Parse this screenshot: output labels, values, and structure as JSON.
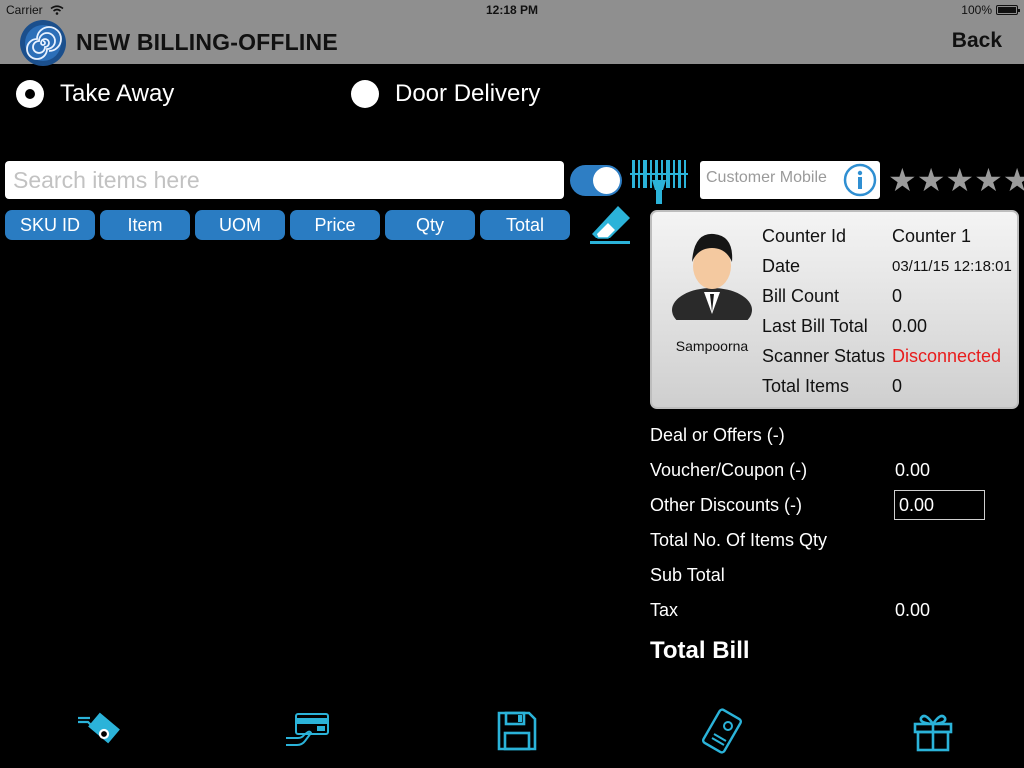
{
  "status_bar": {
    "carrier": "Carrier",
    "time": "12:18 PM",
    "battery": "100%"
  },
  "nav": {
    "title": "NEW BILLING-OFFLINE",
    "back_label": "Back"
  },
  "order_type": {
    "options": [
      {
        "label": "Take Away",
        "selected": true
      },
      {
        "label": "Door Delivery",
        "selected": false
      }
    ]
  },
  "search": {
    "placeholder": "Search items here",
    "value": ""
  },
  "scanner_toggle": {
    "on": true
  },
  "customer": {
    "placeholder": "Customer Mobile",
    "rating": 0,
    "rating_max": 5
  },
  "columns": [
    "SKU ID",
    "Item",
    "UOM",
    "Price",
    "Qty",
    "Total"
  ],
  "counter_card": {
    "user_name": "Sampoorna",
    "rows": [
      {
        "label": "Counter Id",
        "value": "Counter 1"
      },
      {
        "label": "Date",
        "value": "03/11/15 12:18:01"
      },
      {
        "label": "Bill Count",
        "value": "0"
      },
      {
        "label": "Last Bill Total",
        "value": "0.00"
      },
      {
        "label": "Scanner Status",
        "value": "Disconnected"
      },
      {
        "label": "Total Items",
        "value": "0"
      }
    ]
  },
  "summary": {
    "deals_label": "Deal or Offers (-)",
    "voucher_label": "Voucher/Coupon (-)",
    "voucher_value": "0.00",
    "other_discounts_label": "Other Discounts (-)",
    "other_discounts_value": "0.00",
    "total_qty_label": "Total No. Of Items Qty",
    "sub_total_label": "Sub Total",
    "tax_label": "Tax",
    "tax_value": "0.00",
    "total_bill_label": "Total Bill"
  },
  "toolbar": {
    "icons": [
      "cash-payment-icon",
      "card-payment-icon",
      "save-icon",
      "voucher-card-icon",
      "gift-icon"
    ]
  },
  "colors": {
    "accent": "#2a7cc2",
    "icon": "#2bb3d9",
    "nav_bg": "#8f8f8f",
    "error": "#e81d1d"
  }
}
